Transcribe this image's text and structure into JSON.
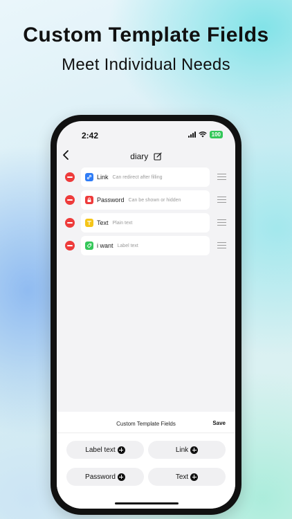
{
  "promo": {
    "headline": "Custom Template Fields",
    "subline": "Meet Individual Needs"
  },
  "status": {
    "time": "2:42",
    "battery": "100"
  },
  "nav": {
    "title": "diary"
  },
  "fields": [
    {
      "name": "Link",
      "hint": "Can redirect after filling",
      "icon": "link-icon",
      "color": "#2f7cf6"
    },
    {
      "name": "Password",
      "hint": "Can be shown or hidden",
      "icon": "lock-icon",
      "color": "#ee3b3b"
    },
    {
      "name": "Text",
      "hint": "Plain text",
      "icon": "text-icon",
      "color": "#f5c518"
    },
    {
      "name": "i want",
      "hint": "Label text",
      "icon": "tag-icon",
      "color": "#34c759"
    }
  ],
  "sheet": {
    "title": "Custom Template Fields",
    "save": "Save",
    "buttons": [
      {
        "label": "Label text"
      },
      {
        "label": "Link"
      },
      {
        "label": "Password"
      },
      {
        "label": "Text"
      }
    ]
  }
}
